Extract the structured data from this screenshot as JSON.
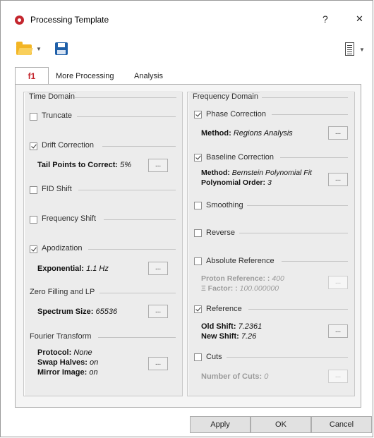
{
  "window": {
    "title": "Processing Template",
    "help": "?",
    "close": "✕"
  },
  "tabs": [
    "f1",
    "More Processing",
    "Analysis"
  ],
  "time_domain": {
    "title": "Time Domain",
    "truncate": {
      "label": "Truncate",
      "checked": false
    },
    "drift": {
      "label": "Drift Correction",
      "checked": true,
      "param_label": "Tail Points to Correct:",
      "param_value": "5%"
    },
    "fid_shift": {
      "label": "FID Shift",
      "checked": false
    },
    "freq_shift": {
      "label": "Frequency Shift",
      "checked": false
    },
    "apodization": {
      "label": "Apodization",
      "checked": true,
      "param_label": "Exponential:",
      "param_value": "1.1 Hz"
    },
    "zero_filling": {
      "title": "Zero Filling and LP",
      "param_label": "Spectrum Size:",
      "param_value": "65536"
    },
    "fourier": {
      "title": "Fourier Transform",
      "protocol_label": "Protocol:",
      "protocol_value": "None",
      "swap_label": "Swap Halves:",
      "swap_value": "on",
      "mirror_label": "Mirror Image:",
      "mirror_value": "on"
    }
  },
  "frequency_domain": {
    "title": "Frequency Domain",
    "phase": {
      "label": "Phase Correction",
      "checked": true,
      "method_label": "Method:",
      "method_value": "Regions Analysis"
    },
    "baseline": {
      "label": "Baseline Correction",
      "checked": true,
      "method_label": "Method:",
      "method_value": "Bernstein Polynomial Fit",
      "order_label": "Polynomial Order:",
      "order_value": "3"
    },
    "smoothing": {
      "label": "Smoothing",
      "checked": false
    },
    "reverse": {
      "label": "Reverse",
      "checked": false
    },
    "absref": {
      "label": "Absolute Reference",
      "checked": false,
      "proton_label": "Proton Reference: :",
      "proton_value": "400",
      "factor_label": "Ξ Factor: :",
      "factor_value": "100.000000"
    },
    "reference": {
      "label": "Reference",
      "checked": true,
      "old_label": "Old Shift:",
      "old_value": "7.2361",
      "new_label": "New Shift:",
      "new_value": "7.26"
    },
    "cuts": {
      "label": "Cuts",
      "checked": false,
      "num_label": "Number of Cuts:",
      "num_value": "0"
    }
  },
  "dots_label": "...",
  "buttons": {
    "apply": "Apply",
    "ok": "OK",
    "cancel": "Cancel"
  },
  "colors": {
    "accent": "#c4262e",
    "folder": "#f3b524",
    "save": "#1f5fa8"
  },
  "icons": {
    "app": "app-logo-icon",
    "open": "folder-open-icon",
    "save": "floppy-disk-icon",
    "menu": "list-menu-icon"
  }
}
